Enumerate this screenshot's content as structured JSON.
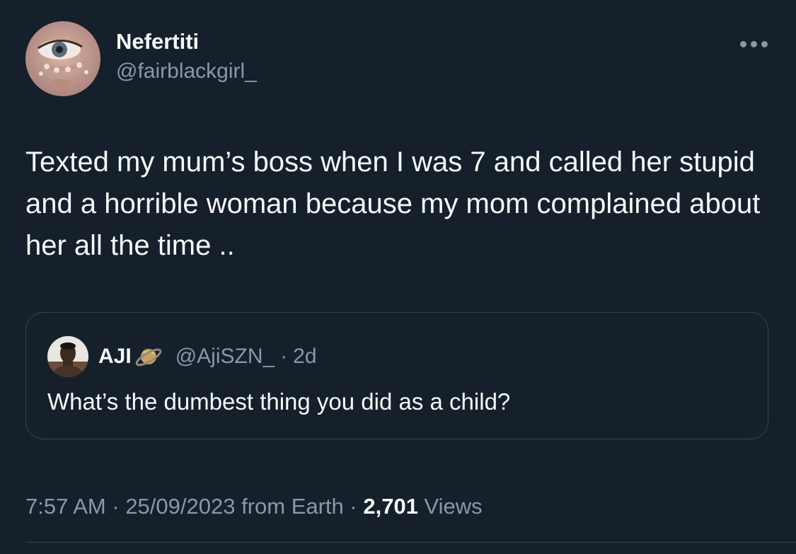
{
  "author": {
    "display_name": "Nefertiti",
    "handle": "@fairblackgirl_",
    "avatar_icon": "profile-photo-eye-avatar"
  },
  "more_icon": "ellipsis-icon",
  "tweet_text": "Texted my mum’s boss when I was 7 and called her stupid and a horrible woman because my mom complained about her all the time ..",
  "quoted": {
    "display_name": "AJI",
    "badge_icon": "saturn-emoji-icon",
    "handle": "@AjiSZN_",
    "separator": "·",
    "time": "2d",
    "text": "What’s the dumbest thing you did as a child?"
  },
  "meta": {
    "time": "7:57 AM",
    "sep1": " · ",
    "date": "25/09/2023",
    "source": " from Earth",
    "sep2": " · ",
    "views_count": "2,701",
    "views_label": " Views"
  },
  "colors": {
    "background": "#15202b",
    "primary_text": "#f7f9f9",
    "secondary_text": "#8b98a5",
    "border": "#38444d"
  }
}
